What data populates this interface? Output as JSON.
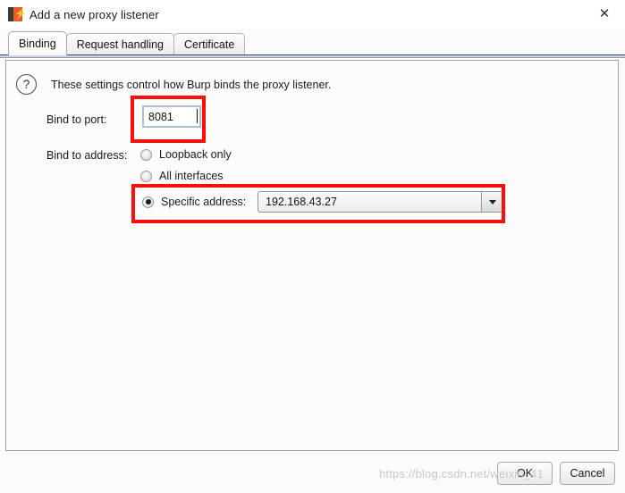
{
  "window": {
    "title": "Add a new proxy listener",
    "icon": "burp-suite-icon",
    "close_label": "✕"
  },
  "tabs": [
    {
      "label": "Binding",
      "active": true
    },
    {
      "label": "Request handling",
      "active": false
    },
    {
      "label": "Certificate",
      "active": false
    }
  ],
  "panel": {
    "help_icon": "?",
    "help_text": "These settings control how Burp binds the proxy listener.",
    "bind_to_port": {
      "label": "Bind to port:",
      "value": "8081"
    },
    "bind_to_address": {
      "label": "Bind to address:",
      "options": [
        {
          "label": "Loopback only",
          "selected": false
        },
        {
          "label": "All interfaces",
          "selected": false
        },
        {
          "label": "Specific address:",
          "selected": true
        }
      ],
      "specific_address_value": "192.168.43.27"
    }
  },
  "footer": {
    "ok_label": "OK",
    "cancel_label": "Cancel"
  },
  "watermark": "https://blog.csdn.net/weixin_41",
  "colors": {
    "annotation_red": "#fb0d09",
    "accent_orange": "#f05a28",
    "tab_underline": "#c9d6ea"
  }
}
